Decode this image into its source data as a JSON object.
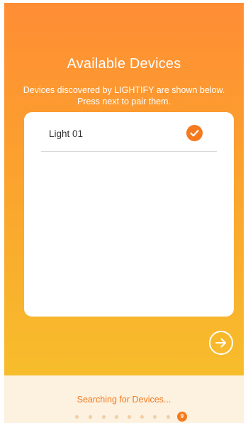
{
  "screen": {
    "title": "Available Devices",
    "subtitle": "Devices discovered by LIGHTIFY are shown below. Press next to pair them."
  },
  "device_list": {
    "items": [
      {
        "name": "Light 01",
        "selected": true,
        "icon": "check-circle-icon"
      }
    ]
  },
  "actions": {
    "next_icon": "arrow-right-circle-icon"
  },
  "footer": {
    "status": "Searching for Devices...",
    "current_step": "9",
    "total_steps": 9
  },
  "colors": {
    "gradient_top": "#ff8d34",
    "gradient_bottom": "#f7bd2c",
    "accent": "#f57a1d",
    "footer_bg": "#fdf1df"
  }
}
